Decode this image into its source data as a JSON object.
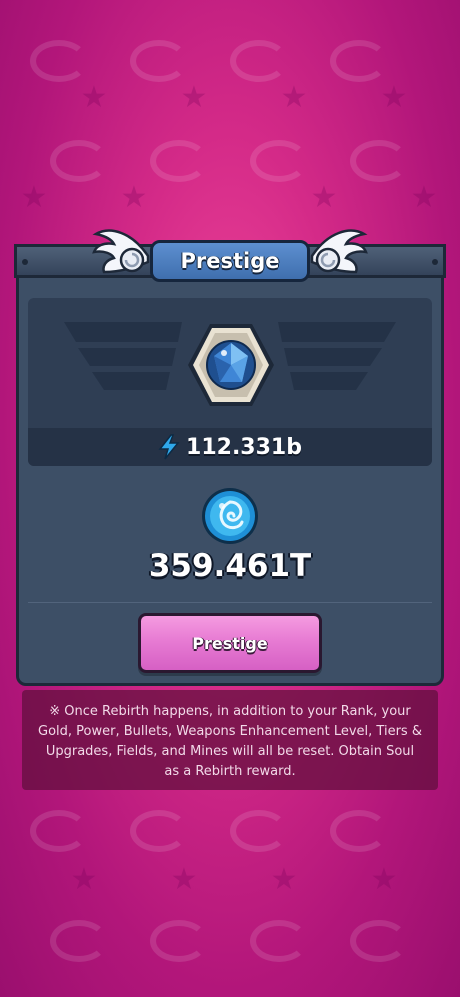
{
  "panel": {
    "title": "Prestige",
    "power_value": "112.331b",
    "soul_value": "359.461T",
    "button_label": "Prestige"
  },
  "notice": {
    "text": "※ Once Rebirth happens, in addition to your Rank, your Gold, Power, Bullets, Weapons Enhancement Level, Tiers & Upgrades, Fields, and Mines will all be reset. Obtain Soul as a Rebirth reward."
  },
  "icons": {
    "power": "lightning-icon",
    "soul": "soul-orb-icon",
    "gem": "diamond-gem-icon",
    "wings": "wing-icon"
  },
  "colors": {
    "background": "#d42a88",
    "panel": "#3d4f66",
    "title_banner": "#4f80c2",
    "button": "#e77bd3",
    "accent_blue": "#2fa8ea"
  }
}
